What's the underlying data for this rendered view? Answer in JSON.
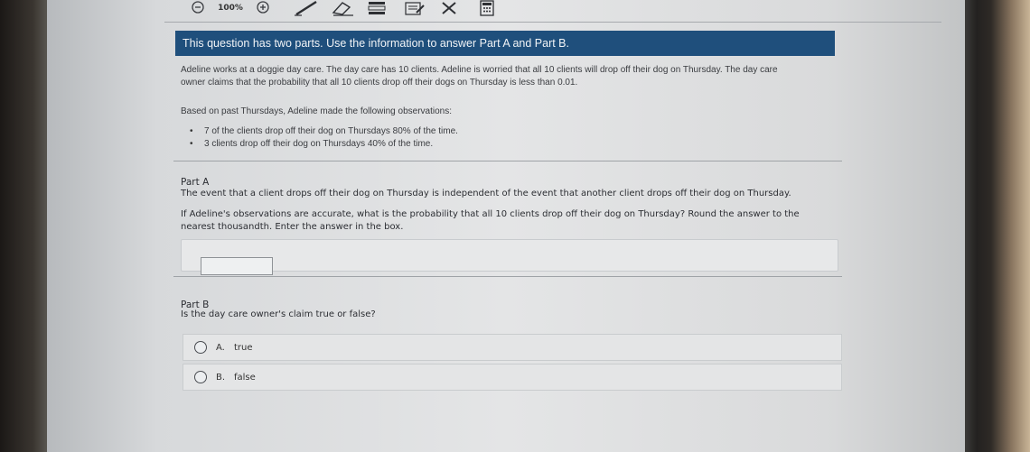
{
  "toolbar": {
    "zoom": "100%",
    "icons": [
      "zoom-out-icon",
      "zoom-in-icon",
      "pencil-icon",
      "eraser-icon",
      "line-reader-icon",
      "highlighter-icon",
      "cross-out-icon",
      "calculator-icon"
    ]
  },
  "banner": "This question has two parts. Use the information to answer Part A and Part B.",
  "intro": {
    "line1": "Adeline works at a doggie day care. The day care has 10 clients. Adeline is worried that all 10 clients will drop off their dog on Thursday. The day care",
    "line2": "owner claims that the probability that all 10 clients drop off their dogs on Thursday is less than 0.01."
  },
  "observations_intro": "Based on past Thursdays, Adeline made the following observations:",
  "observations": [
    "7 of the clients drop off their dog on Thursdays 80% of the time.",
    "3 clients drop off their dog on Thursdays 40% of the time."
  ],
  "part_a": {
    "title": "Part A",
    "statement": "The event that a client drops off their dog on Thursday is independent of the event that another client drops off their dog on Thursday.",
    "question_line1": "If Adeline's observations are accurate, what is the probability that all 10 clients drop off their dog on Thursday? Round the answer to the",
    "question_line2": "nearest thousandth. Enter the answer in the box.",
    "answer_value": ""
  },
  "part_b": {
    "title": "Part B",
    "question": "Is the day care owner's claim true or false?",
    "choices": [
      {
        "letter": "A.",
        "text": "true"
      },
      {
        "letter": "B.",
        "text": "false"
      }
    ]
  }
}
